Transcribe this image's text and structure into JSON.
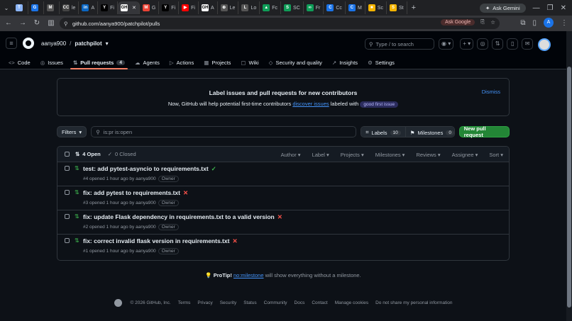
{
  "browser": {
    "tabs": [
      {
        "label": "",
        "color": "#8ab4f8",
        "icon": "T"
      },
      {
        "label": "",
        "color": "#1a73e8",
        "icon": "G"
      },
      {
        "label": "",
        "color": "#555",
        "icon": "M"
      },
      {
        "label": "le",
        "color": "#444",
        "icon": "CC"
      },
      {
        "label": "A",
        "color": "#0a66c2",
        "icon": "in"
      },
      {
        "label": "Fi",
        "color": "#000",
        "icon": "Y"
      },
      {
        "label": "",
        "color": "#fff",
        "icon": "GH",
        "active": true
      },
      {
        "label": "G",
        "color": "#ea4335",
        "icon": "M"
      },
      {
        "label": "Fi",
        "color": "#000",
        "icon": "Y"
      },
      {
        "label": "Fi",
        "color": "#ff0000",
        "icon": "▶"
      },
      {
        "label": "A",
        "color": "#fff",
        "icon": "GH"
      },
      {
        "label": "Le",
        "color": "#555",
        "icon": "⊕"
      },
      {
        "label": "Lo",
        "color": "#555",
        "icon": "L"
      },
      {
        "label": "Fc",
        "color": "#0f9d58",
        "icon": "▲"
      },
      {
        "label": "SC",
        "color": "#0f9d58",
        "icon": "S"
      },
      {
        "label": "Fr",
        "color": "#0f9d58",
        "icon": "∞"
      },
      {
        "label": "Cc",
        "color": "#1a73e8",
        "icon": "C"
      },
      {
        "label": "M",
        "color": "#1a73e8",
        "icon": "C"
      },
      {
        "label": "Sc",
        "color": "#f4b400",
        "icon": "■"
      },
      {
        "label": "St",
        "color": "#f4b400",
        "icon": "S"
      }
    ],
    "new_tab": "+",
    "ask_gemini": "Ask Gemini",
    "url": "github.com/aanya900/patchpilot/pulls",
    "ask_google": "Ask Google",
    "profile_initial": "A"
  },
  "github": {
    "owner": "aanya900",
    "repo": "patchpilot",
    "search_placeholder": "Type / to search",
    "nav": [
      {
        "label": "Code",
        "icon": "<>"
      },
      {
        "label": "Issues",
        "icon": "◎"
      },
      {
        "label": "Pull requests",
        "icon": "⇅",
        "count": "4",
        "active": true
      },
      {
        "label": "Agents",
        "icon": "☁"
      },
      {
        "label": "Actions",
        "icon": "▷"
      },
      {
        "label": "Projects",
        "icon": "▦"
      },
      {
        "label": "Wiki",
        "icon": "▢"
      },
      {
        "label": "Security and quality",
        "icon": "◇"
      },
      {
        "label": "Insights",
        "icon": "↗"
      },
      {
        "label": "Settings",
        "icon": "⚙"
      }
    ]
  },
  "banner": {
    "title": "Label issues and pull requests for new contributors",
    "desc_pre": "Now, GitHub will help potential first-time contributors",
    "desc_link": "discover issues",
    "desc_mid": "labeled with",
    "label": "good first issue",
    "dismiss": "Dismiss"
  },
  "filters": {
    "filters_label": "Filters",
    "query": "is:pr is:open",
    "labels_label": "Labels",
    "labels_count": "10",
    "milestones_label": "Milestones",
    "milestones_count": "0",
    "new_pr": "New pull request"
  },
  "list": {
    "open_label": "4 Open",
    "closed_label": "0 Closed",
    "facets": [
      "Author",
      "Label",
      "Projects",
      "Milestones",
      "Reviews",
      "Assignee",
      "Sort"
    ],
    "rows": [
      {
        "title": "test: add pytest-asyncio to requirements.txt",
        "status": "ok",
        "meta": "#4 opened 1 hour ago by aanya900",
        "badge": "Owner"
      },
      {
        "title": "fix: add pytest to requirements.txt",
        "status": "fail",
        "meta": "#3 opened 1 hour ago by aanya900",
        "badge": "Owner"
      },
      {
        "title": "fix: update Flask dependency in requirements.txt to a valid version",
        "status": "fail",
        "meta": "#2 opened 1 hour ago by aanya900",
        "badge": "Owner"
      },
      {
        "title": "fix: correct invalid flask version in requirements.txt",
        "status": "fail",
        "meta": "#1 opened 1 hour ago by aanya900",
        "badge": "Owner"
      }
    ]
  },
  "protip": {
    "label": "ProTip!",
    "link": "no:milestone",
    "text": "will show everything without a milestone."
  },
  "footer": {
    "copyright": "© 2026 GitHub, Inc.",
    "links": [
      "Terms",
      "Privacy",
      "Security",
      "Status",
      "Community",
      "Docs",
      "Contact",
      "Manage cookies",
      "Do not share my personal information"
    ]
  }
}
